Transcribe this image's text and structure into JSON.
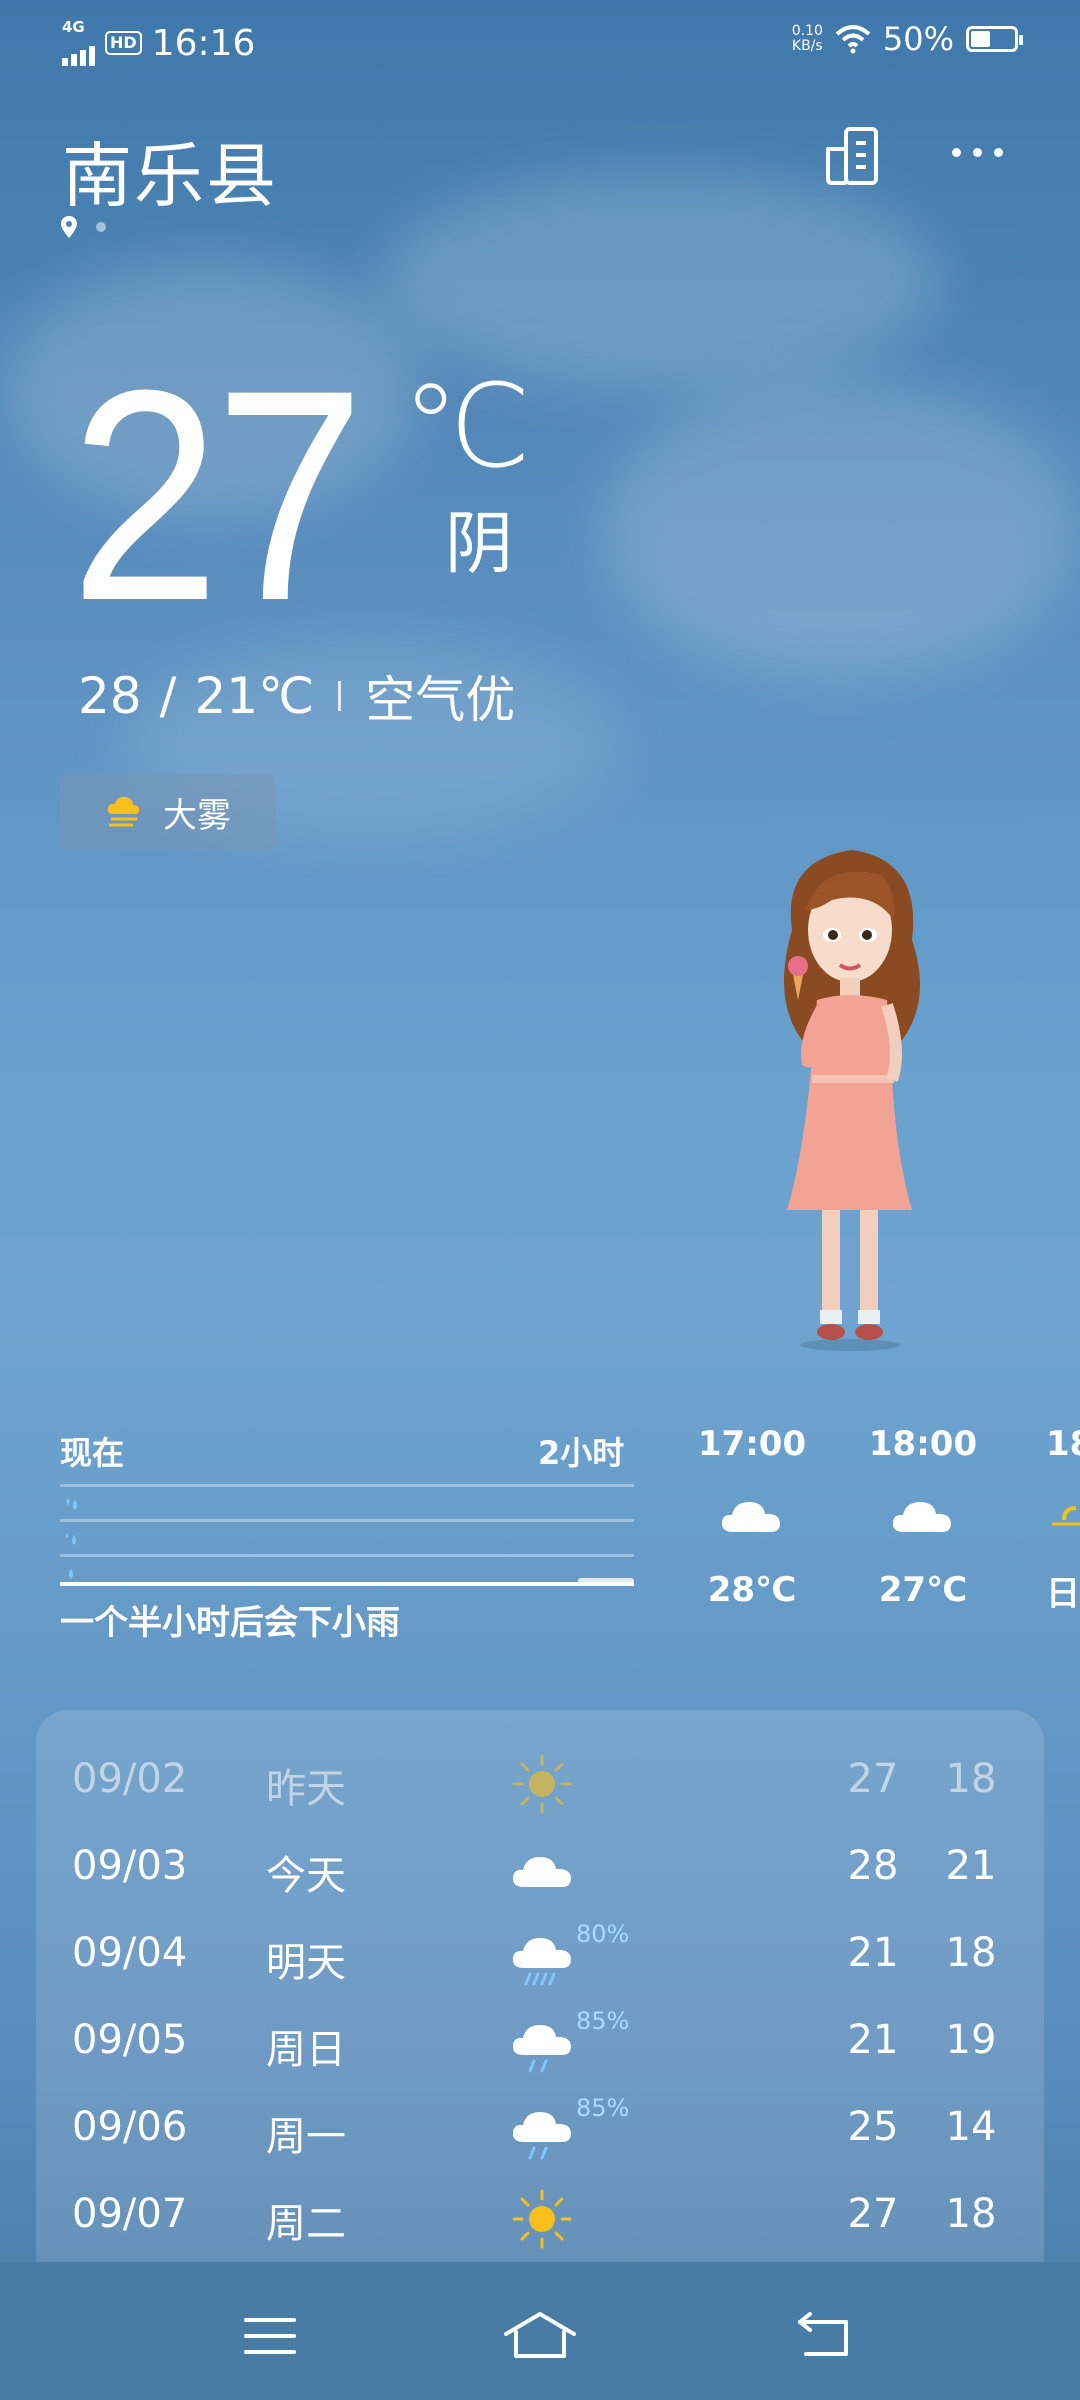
{
  "status_bar": {
    "network": "4G",
    "hd": "HD",
    "time": "16:16",
    "net_speed_value": "0.10",
    "net_speed_unit": "KB/s",
    "battery_text": "50%",
    "battery_level": 0.5
  },
  "header": {
    "city": "南乐县"
  },
  "current": {
    "temperature": "27",
    "unit": "℃",
    "condition": "阴",
    "high": "28",
    "separator": "/",
    "low": "21℃",
    "air_quality": "空气优"
  },
  "alert": {
    "label": "大雾",
    "icon": "fog-icon"
  },
  "precipitation": {
    "now_label": "现在",
    "end_label": "2小时",
    "summary": "一个半小时后会下小雨"
  },
  "hourly": [
    {
      "time": "17:00",
      "icon": "cloud-icon",
      "temp": "28℃"
    },
    {
      "time": "18:00",
      "icon": "cloud-icon",
      "temp": "27℃"
    },
    {
      "time": "18",
      "icon": "sunset-icon",
      "temp": "日"
    }
  ],
  "daily": [
    {
      "date": "09/02",
      "label": "昨天",
      "icon": "sun-icon",
      "pop": "",
      "high": "27",
      "low": "18",
      "past": true
    },
    {
      "date": "09/03",
      "label": "今天",
      "icon": "cloud-icon",
      "pop": "",
      "high": "28",
      "low": "21",
      "past": false
    },
    {
      "date": "09/04",
      "label": "明天",
      "icon": "rain-cloud-icon",
      "pop": "80%",
      "high": "21",
      "low": "18",
      "past": false
    },
    {
      "date": "09/05",
      "label": "周日",
      "icon": "rain-cloud-icon",
      "pop": "85%",
      "high": "21",
      "low": "19",
      "past": false
    },
    {
      "date": "09/06",
      "label": "周一",
      "icon": "rain-cloud-icon",
      "pop": "85%",
      "high": "25",
      "low": "14",
      "past": false
    },
    {
      "date": "09/07",
      "label": "周二",
      "icon": "sun-icon",
      "pop": "",
      "high": "27",
      "low": "18",
      "past": false
    }
  ],
  "colors": {
    "sun": "#f5c01a",
    "rain_drop": "#7ec8ff",
    "popularity_text": "#a8dcff"
  }
}
